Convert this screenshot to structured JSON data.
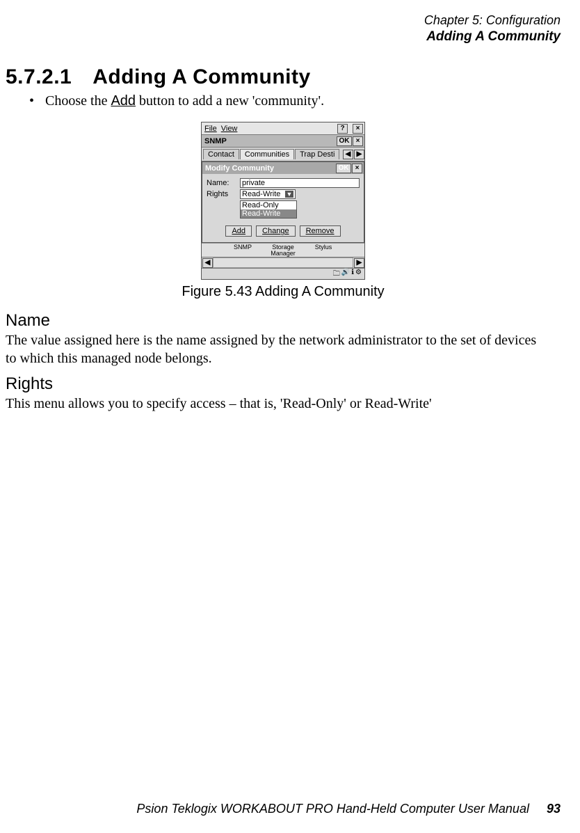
{
  "header": {
    "chapter_line": "Chapter 5: Configuration",
    "chapter_sub": "Adding A Community"
  },
  "section": {
    "number": "5.7.2.1",
    "title": "Adding A Community",
    "bullet_pre": "Choose the ",
    "bullet_add": "Add",
    "bullet_post": " button to add a new 'community'."
  },
  "figure_caption": "Figure 5.43 Adding A Community",
  "shot": {
    "menu_file": "File",
    "menu_view": "View",
    "snmp_title": "SNMP",
    "ok": "OK",
    "help": "?",
    "close": "×",
    "tabs": {
      "contact": "Contact",
      "communities": "Communities",
      "trap": "Trap Desti"
    },
    "arrows": {
      "left": "◀",
      "right": "▶",
      "up": "▲",
      "down": "▼"
    },
    "modify_title": "Modify Community",
    "name_label": "Name:",
    "name_value": "private",
    "rights_label": "Rights",
    "rights_value": "Read-Write",
    "rights_opts": {
      "ro": "Read-Only",
      "rw": "Read-Write"
    },
    "btn_add": "Add",
    "btn_change": "Change",
    "btn_remove": "Remove",
    "icons": {
      "snmp": "SNMP",
      "storage": "Storage Manager",
      "stylus": "Stylus"
    }
  },
  "name_head": "Name",
  "name_para": "The value assigned here is the name assigned by the network administrator to the set of devices to which this managed node belongs.",
  "rights_head": "Rights",
  "rights_para": "This menu allows you to specify access – that is, 'Read-Only' or Read-Write'",
  "footer": {
    "text": "Psion Teklogix WORKABOUT PRO Hand-Held Computer User Manual",
    "page": "93"
  }
}
